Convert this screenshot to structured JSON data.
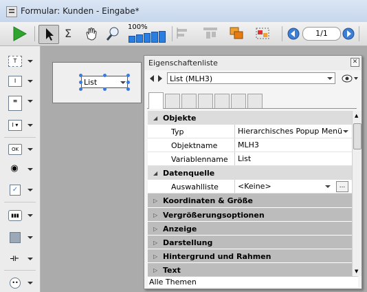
{
  "window": {
    "title": "Formular: Kunden - Eingabe*"
  },
  "toolbar": {
    "zoom_label": "100%",
    "page_indicator": "1/1",
    "icons": [
      "run-form-icon",
      "arrow-select-icon",
      "order-icon",
      "hand-icon",
      "zoom-icon",
      "align-icon",
      "distribute-icon",
      "level-icon",
      "group-icon",
      "page-prev-icon",
      "page-next-icon"
    ]
  },
  "object_tools": [
    "text-tool-icon",
    "field-tool-icon",
    "list-tool-icon",
    "combo-tool-icon",
    "button-tool-icon",
    "radio-tool-icon",
    "check-tool-icon",
    "tab-tool-icon",
    "shape-tool-icon",
    "splitter-tool-icon",
    "plugin-tool-icon"
  ],
  "form": {
    "popup_value": "List"
  },
  "properties": {
    "title": "Eigenschaftenliste",
    "selected_object": "List (MLH3)",
    "rows": [
      {
        "kind": "category",
        "label": "Objekte",
        "expanded": true
      },
      {
        "kind": "prop",
        "label": "Typ",
        "value": "Hierarchisches Popup Menü"
      },
      {
        "kind": "prop",
        "label": "Objektname",
        "value": "MLH3"
      },
      {
        "kind": "prop",
        "label": "Variablenname",
        "value": "List"
      },
      {
        "kind": "category",
        "label": "Datenquelle",
        "expanded": true
      },
      {
        "kind": "prop",
        "label": "Auswahlliste",
        "value": "<Keine>"
      },
      {
        "kind": "group",
        "label": "Koordinaten & Größe"
      },
      {
        "kind": "group",
        "label": "Vergrößerungsoptionen"
      },
      {
        "kind": "group",
        "label": "Anzeige"
      },
      {
        "kind": "group",
        "label": "Darstellung"
      },
      {
        "kind": "group",
        "label": "Hintergrund und Rahmen"
      },
      {
        "kind": "group",
        "label": "Text"
      }
    ],
    "footer": "Alle Themen",
    "colors": {
      "group_bg": "#bcbcbc",
      "category_bg": "#dcdcdc"
    }
  }
}
